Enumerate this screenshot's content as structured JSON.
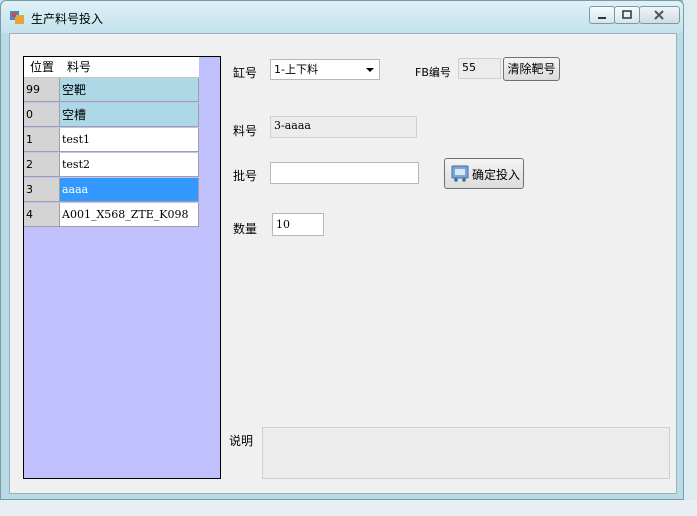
{
  "window": {
    "title": "生产料号投入"
  },
  "grid": {
    "headers": {
      "position": "位置",
      "part_no": "料号"
    },
    "rows": [
      {
        "position": "99",
        "part_no": "空靶",
        "state": "empty"
      },
      {
        "position": "0",
        "part_no": "空槽",
        "state": "empty"
      },
      {
        "position": "1",
        "part_no": "test1",
        "state": "normal"
      },
      {
        "position": "2",
        "part_no": "test2",
        "state": "normal"
      },
      {
        "position": "3",
        "part_no": "aaaa",
        "state": "selected"
      },
      {
        "position": "4",
        "part_no": "A001_X568_ZTE_K098",
        "state": "normal"
      }
    ]
  },
  "form": {
    "cylinder_label": "缸号",
    "cylinder_value": "1-上下料",
    "fb_label": "FB编号",
    "fb_value": "55",
    "clear_button": "清除靶号",
    "part_label": "料号",
    "part_value": "3-aaaa",
    "batch_label": "批号",
    "batch_value": "",
    "confirm_button": "确定投入",
    "qty_label": "数量",
    "qty_value": "10",
    "note_label": "说明",
    "note_value": ""
  }
}
